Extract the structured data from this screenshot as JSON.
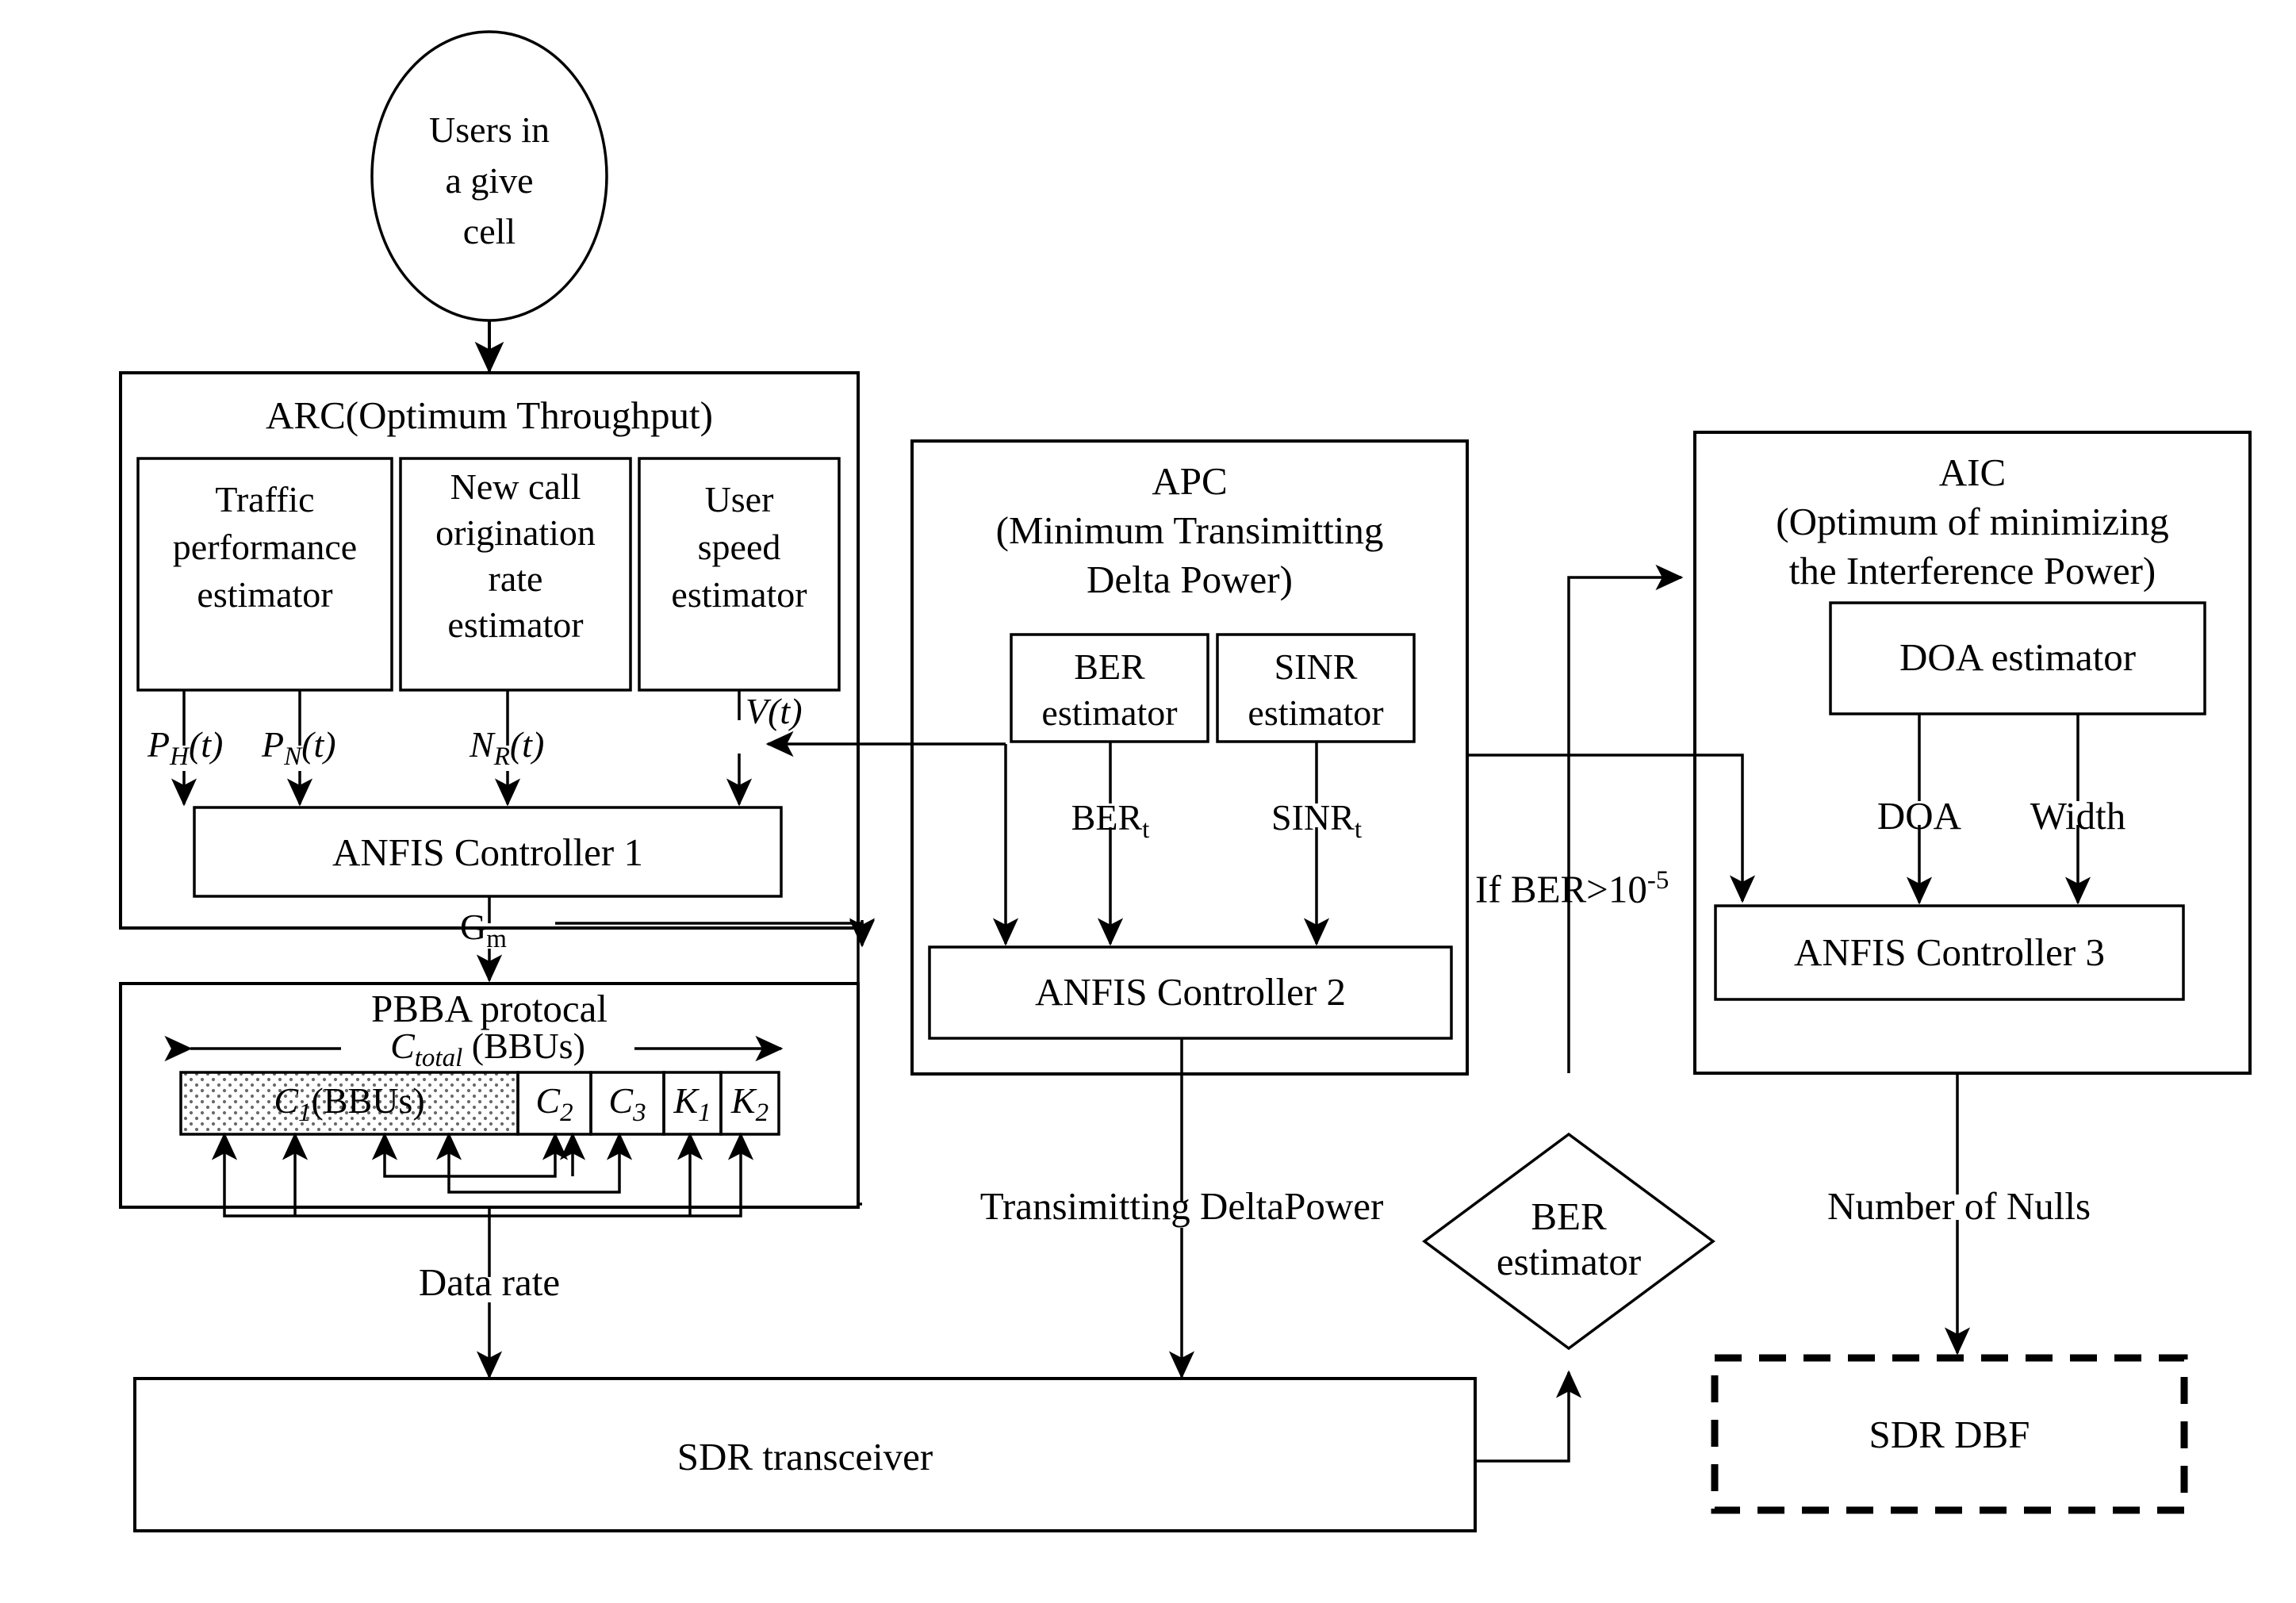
{
  "diagram": {
    "title_nodes": {
      "source": "Users in\na give\ncell",
      "source_l1": "Users in",
      "source_l2": "a give",
      "source_l3": "cell"
    },
    "arc": {
      "title": "ARC(Optimum Throughput)",
      "estimators": [
        {
          "l1": "Traffic",
          "l2": "performance",
          "l3": "estimator"
        },
        {
          "l1": "New call",
          "l2": "origination",
          "l3": "rate",
          "l4": "estimator"
        },
        {
          "l1": "User",
          "l2": "speed",
          "l3": "estimator"
        }
      ],
      "signals": {
        "ph": "P",
        "ph_sub": "H",
        "ph_arg": "(t)",
        "pn": "P",
        "pn_sub": "N",
        "pn_arg": "(t)",
        "nr": "N",
        "nr_sub": "R",
        "nr_arg": "(t)",
        "vt": "V(t)"
      },
      "controller": "ANFIS  Controller 1",
      "output_label": "G",
      "output_label_sub": "m"
    },
    "pbba": {
      "title": "PBBA protocal",
      "total_label": "C",
      "total_label_sub": "total",
      "total_label_unit": " (BBUs)",
      "segments": [
        {
          "label": "C",
          "sub": "1",
          "unit": "(BBUs)"
        },
        {
          "label": "C",
          "sub": "2",
          "unit": ""
        },
        {
          "label": "C",
          "sub": "3",
          "unit": ""
        },
        {
          "label": "K",
          "sub": "1",
          "unit": ""
        },
        {
          "label": "K",
          "sub": "2",
          "unit": ""
        }
      ],
      "output_label": "Data rate"
    },
    "apc": {
      "title_l1": "APC",
      "title_l2": "(Minimum Transimitting",
      "title_l3": "Delta Power)",
      "estimators": [
        {
          "l1": "BER",
          "l2": "estimator"
        },
        {
          "l1": "SINR",
          "l2": "estimator"
        }
      ],
      "signals": {
        "ber_t": "BER",
        "ber_t_sub": "t",
        "sinr_t": "SINR",
        "sinr_t_sub": "t"
      },
      "controller": "ANFIS  Controller 2",
      "output_label": "Transimitting DeltaPower"
    },
    "aic": {
      "title_l1": "AIC",
      "title_l2": "(Optimum of minimizing",
      "title_l3": "the Interference Power)",
      "estimator": "DOA estimator",
      "signals": {
        "doa": "DOA",
        "width": "Width"
      },
      "controller": "ANFIS Controller 3",
      "output_label": "Number of Nulls"
    },
    "decision": {
      "l1": "BER",
      "l2": "estimator",
      "condition": "If BER>10",
      "condition_exp": "-5"
    },
    "bottom": {
      "sdr_transceiver": "SDR transceiver",
      "sdr_dbf": "SDR DBF"
    },
    "colors": {
      "stroke": "#000000",
      "background": "#ffffff"
    }
  }
}
